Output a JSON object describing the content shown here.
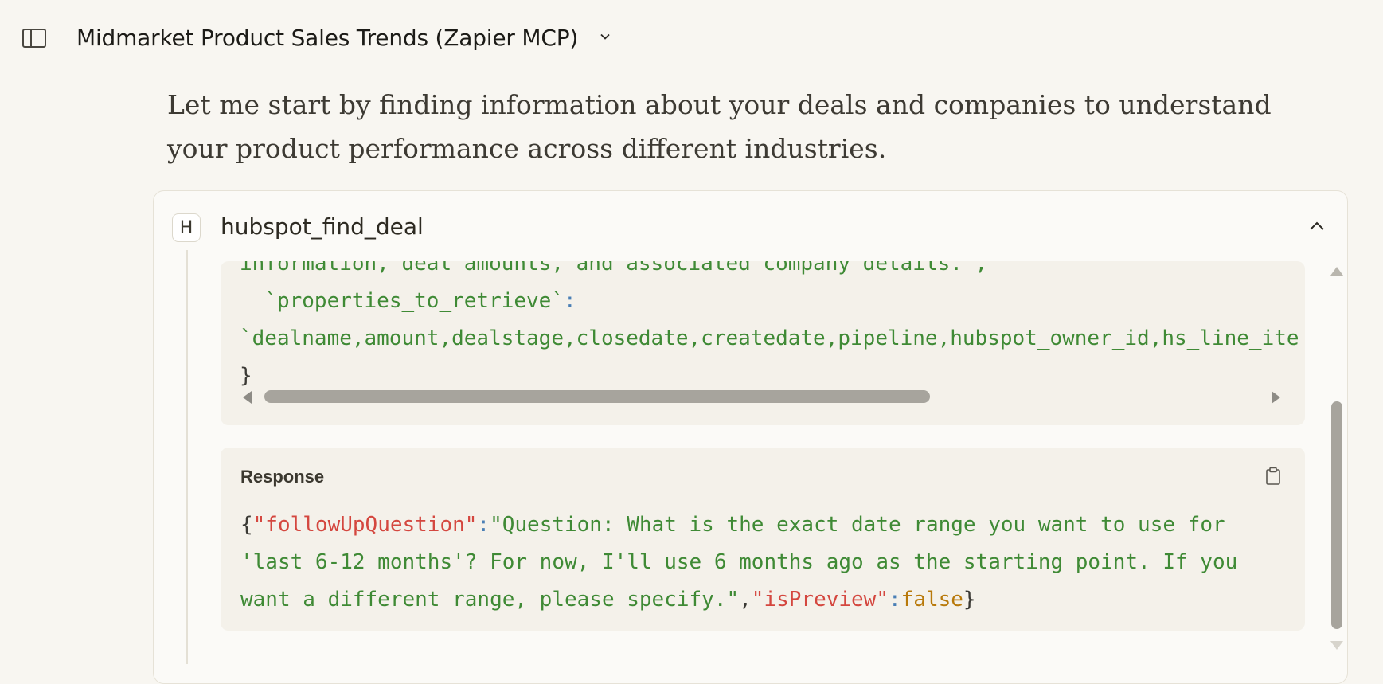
{
  "header": {
    "title": "Midmarket Product Sales Trends (Zapier MCP)",
    "sidebar_toggle_icon": "sidebar-panel-icon",
    "title_menu_icon": "chevron-down-icon"
  },
  "intro_text": "Let me start by finding information about your deals and companies to understand your product performance across different industries.",
  "tool_call": {
    "badge": "H",
    "name": "hubspot_find_deal",
    "collapse_icon": "chevron-up-icon",
    "request_lines": {
      "line1": "information, deal amounts, and associated company details.\",",
      "line2_key": "  `properties_to_retrieve`",
      "line2_colon": ":",
      "line3": "`dealname,amount,dealstage,closedate,createdate,pipeline,hubspot_owner_id,hs_line_ite",
      "line4": "}"
    },
    "response": {
      "label": "Response",
      "copy_icon": "clipboard-icon",
      "open_brace": "{",
      "key1": "\"followUpQuestion\"",
      "colon1": ":",
      "value1_part1": "\"Question: What is the exact date range you want to use for",
      "value1_part2": "'last 6-12 months'? For now, I'll use 6 months ago as the starting point. If you",
      "value1_part3": "want a different range, please specify.\"",
      "comma": ",",
      "key2": "\"isPreview\"",
      "colon2": ":",
      "value2": "false",
      "close_brace": "}"
    }
  },
  "colors": {
    "background": "#f8f6f1",
    "string_green": "#3f8a35",
    "key_red": "#d4473f",
    "colon_blue": "#4a7fb5",
    "boolean_orange": "#b8790a"
  }
}
